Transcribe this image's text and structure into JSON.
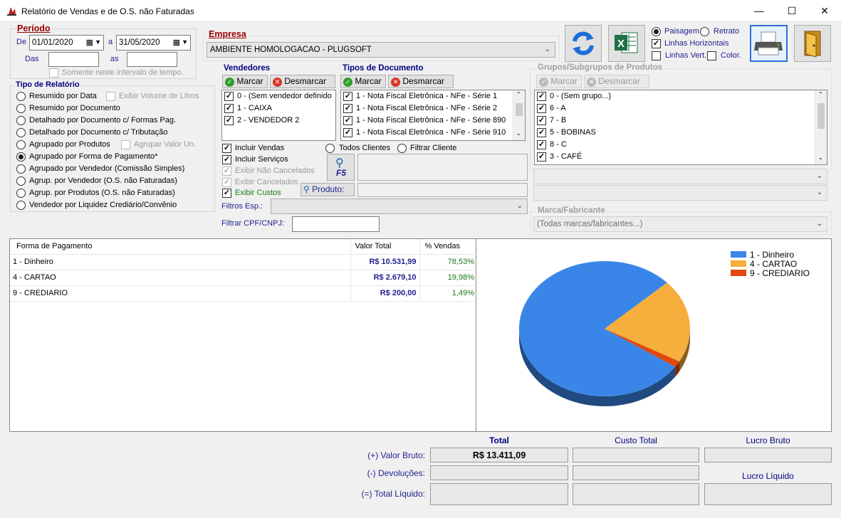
{
  "window": {
    "title": "Relatório de Vendas e de O.S. não Faturadas",
    "minimize": "—",
    "maximize": "☐",
    "close": "✕"
  },
  "periodo": {
    "legend": "Período",
    "de_label": "De",
    "de_value": "01/01/2020",
    "a_label": "a",
    "a_value": "31/05/2020",
    "das_label": "Das",
    "as_label": "as",
    "interval_label": "Somente neste intervalo de tempo."
  },
  "empresa": {
    "legend": "Empresa",
    "value": "AMBIENTE HOMOLOGACAO - PLUGSOFT"
  },
  "options": {
    "paisagem": "Paisagem",
    "retrato": "Retrato",
    "linhas_horizontais": "Linhas Horizontais",
    "linhas_vert": "Linhas Vert.",
    "color": "Color."
  },
  "tipo_relatorio": {
    "legend": "Tipo de Relatório",
    "items": [
      "Resumido por Data",
      "Resumido por Documento",
      "Detalhado por Documento c/ Formas Pag.",
      "Detalhado por Documento c/ Tributação",
      "Agrupado por Produtos",
      "Agrupado por Forma de Pagamento*",
      "Agrupado por Vendedor (Comissão Simples)",
      "Agrup. por Vendedor (O.S. não Faturadas)",
      "Agrup. por Produtos (O.S. não Faturadas)",
      "Vendedor por Liquidez Crediário/Convênio"
    ],
    "exibir_volume": "Exibir Volume de Litros",
    "agrupar_valor": "Agrupar Valor Un."
  },
  "vendedores": {
    "legend": "Vendedores",
    "marcar": "Marcar",
    "desmarcar": "Desmarcar",
    "items": [
      "0 - (Sem vendedor definido",
      "1 - CAIXA",
      "2 - VENDEDOR 2"
    ]
  },
  "tipos_documento": {
    "legend": "Tipos de Documento",
    "marcar": "Marcar",
    "desmarcar": "Desmarcar",
    "items": [
      "1 - Nota Fiscal Eletrônica - NFe - Série 1",
      "1 - Nota Fiscal Eletrônica - NFe - Série 2",
      "1 - Nota Fiscal Eletrônica - NFe - Série 890",
      "1 - Nota Fiscal Eletrônica - NFe - Série 910"
    ]
  },
  "grupos": {
    "legend": "Grupos/Subgrupos de Produtos",
    "marcar": "Marcar",
    "desmarcar": "Desmarcar",
    "items": [
      "0 - (Sem grupo...)",
      "6 - A",
      "7 - B",
      "5 - BOBINAS",
      "8 - C",
      "3 - CAFÉ"
    ]
  },
  "filters": {
    "incluir_vendas": "Incluir Vendas",
    "incluir_servicos": "Incluir Serviços",
    "exibir_nao_cancelados": "Exibir Não Cancelados",
    "exibir_cancelados": "Exibir Cancelados",
    "exibir_custos": "Exibir Custos",
    "todos_clientes": "Todos Clientes",
    "filtrar_cliente": "Filtrar Cliente",
    "f5": "F5",
    "produto": "Produto:",
    "filtros_esp": "Filtros Esp.:",
    "filtrar_cpf": "Filtrar CPF/CNPJ:"
  },
  "marca": {
    "legend": "Marca/Fabricante",
    "value": "(Todas marcas/fabricantes...)"
  },
  "table": {
    "headers": [
      "Forma de Pagamento",
      "Valor Total",
      "% Vendas"
    ],
    "rows": [
      [
        "1 - Dinheiro",
        "R$ 10.531,99",
        "78,53%"
      ],
      [
        "4 - CARTAO",
        "R$ 2.679,10",
        "19,98%"
      ],
      [
        "9 - CREDIARIO",
        "R$ 200,00",
        "1,49%"
      ]
    ]
  },
  "chart_data": {
    "type": "pie",
    "categories": [
      "1 - Dinheiro",
      "4 - CARTAO",
      "9 - CREDIARIO"
    ],
    "values": [
      78.53,
      19.98,
      1.49
    ],
    "colors": [
      "#3a86e8",
      "#f6ae3c",
      "#e0480e"
    ],
    "legend": "top-right"
  },
  "totals": {
    "total_hdr": "Total",
    "custo_hdr": "Custo Total",
    "lucro_bruto_hdr": "Lucro Bruto",
    "lucro_liquido_hdr": "Lucro Líquido",
    "valor_bruto_lbl": "(+) Valor Bruto:",
    "devolucoes_lbl": "(-) Devoluções:",
    "total_liquido_lbl": "(=) Total Líquido:",
    "valor_bruto": "R$ 13.411,09"
  }
}
